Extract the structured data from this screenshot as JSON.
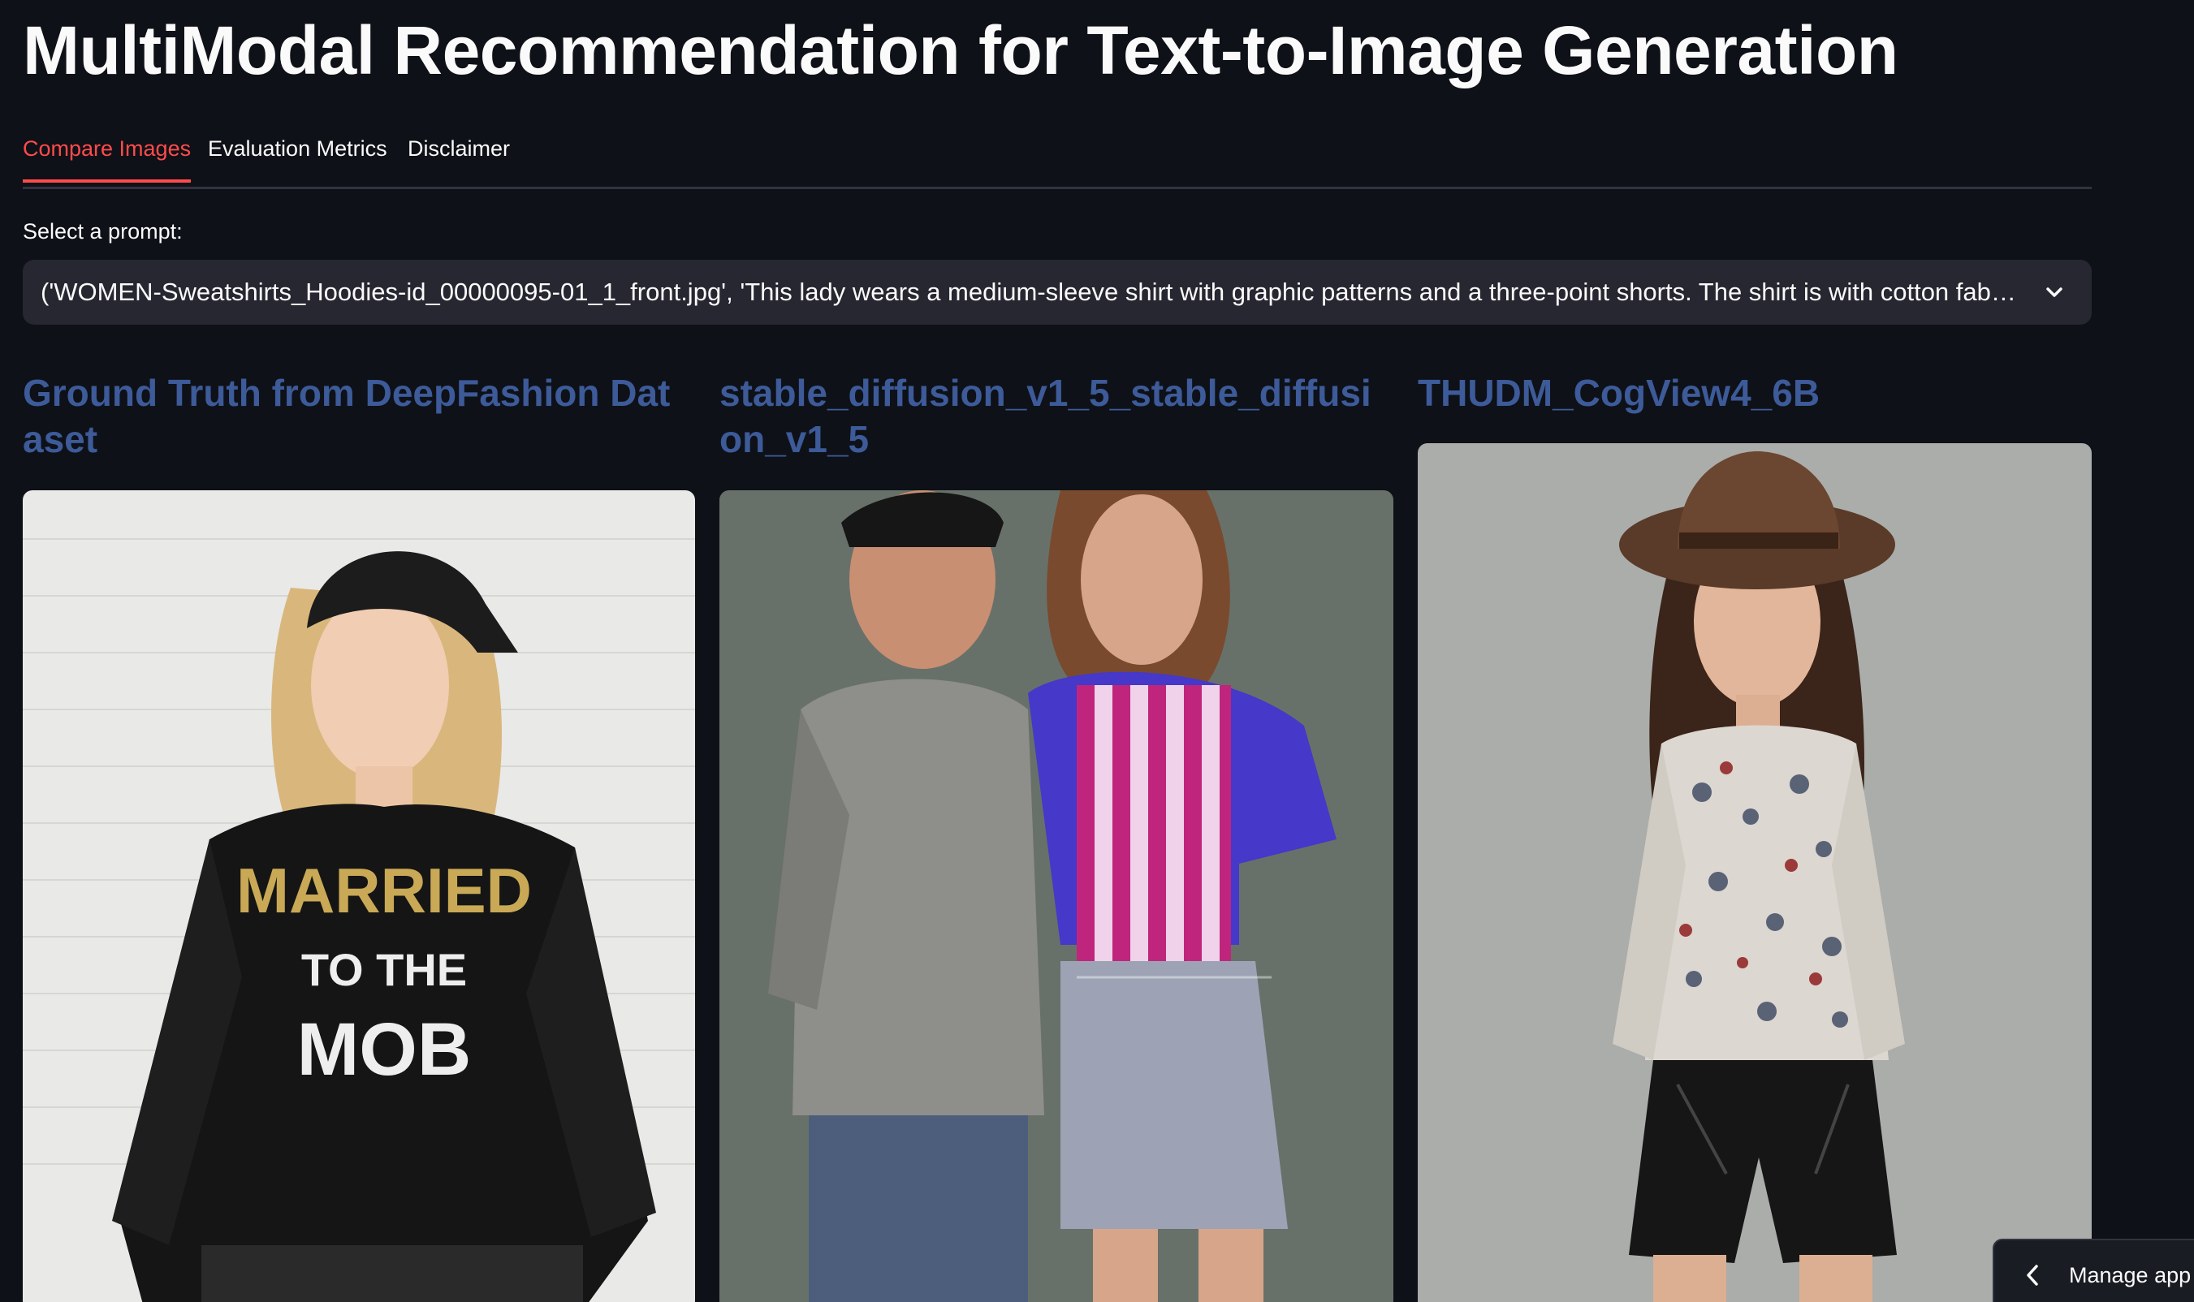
{
  "app": {
    "title": "MultiModal Recommendation for Text-to-Image Generation"
  },
  "tabs": [
    {
      "label": "Compare Images",
      "active": true
    },
    {
      "label": "Evaluation Metrics",
      "active": false
    },
    {
      "label": "Disclaimer",
      "active": false
    }
  ],
  "prompt": {
    "label": "Select a prompt:",
    "selected": "('WOMEN-Sweatshirts_Hoodies-id_00000095-01_1_front.jpg', 'This lady wears a medium-sleeve shirt with graphic patterns and a three-point shorts. The shirt is with cotton fabric an…"
  },
  "columns": [
    {
      "title": "Ground Truth from DeepFashion Dataset",
      "image_icon": "photo-sweatshirt-model-icon"
    },
    {
      "title": "stable_diffusion_v1_5_stable_diffusion_v1_5",
      "image_icon": "photo-two-women-icon"
    },
    {
      "title": "THUDM_CogView4_6B",
      "image_icon": "photo-hat-model-icon"
    }
  ],
  "footer": {
    "manage_app_label": "Manage app"
  },
  "colors": {
    "background": "#0e1117",
    "accent": "#ff4b4b",
    "column_title": "#3d5a99",
    "select_bg": "#262730"
  }
}
